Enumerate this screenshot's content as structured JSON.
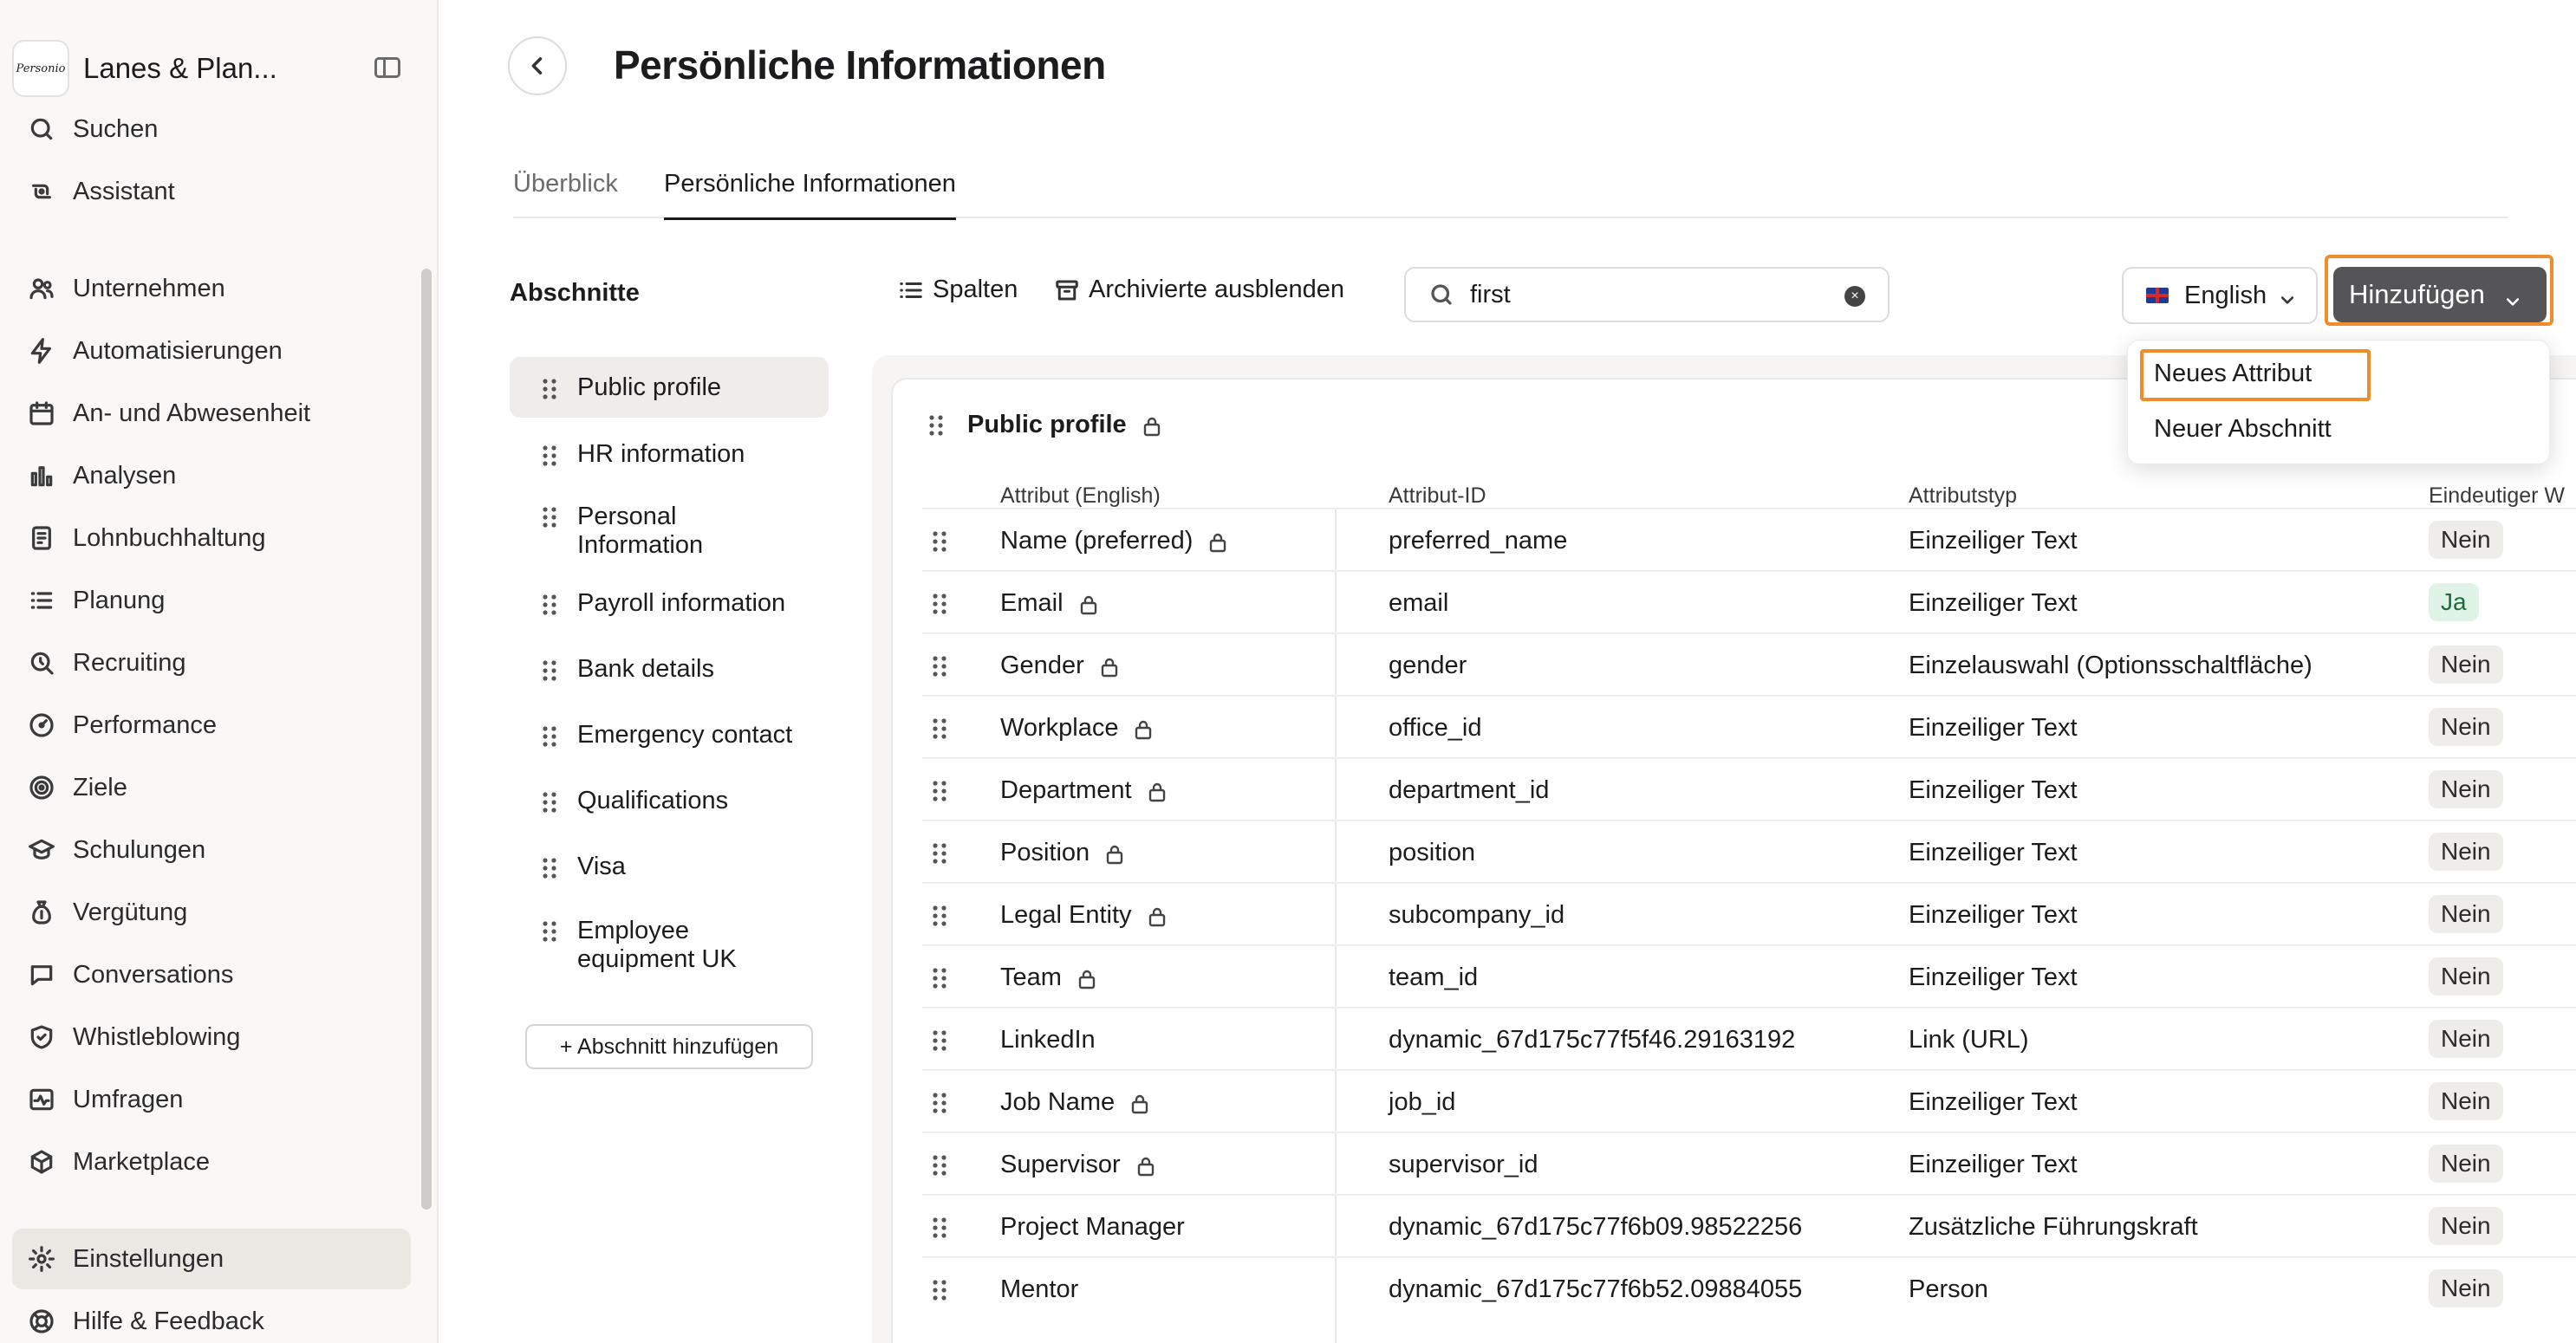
{
  "sidebar": {
    "company": "Lanes & Plan...",
    "logo_text": "Personio",
    "items": [
      {
        "label": "Suchen",
        "icon": "search-icon"
      },
      {
        "label": "Assistant",
        "icon": "assistant-icon"
      },
      {
        "label": "Unternehmen",
        "icon": "people-icon"
      },
      {
        "label": "Automatisierungen",
        "icon": "lightning-icon"
      },
      {
        "label": "An- und Abwesenheit",
        "icon": "calendar-icon"
      },
      {
        "label": "Analysen",
        "icon": "bar-chart-icon"
      },
      {
        "label": "Lohnbuchhaltung",
        "icon": "payroll-icon"
      },
      {
        "label": "Planung",
        "icon": "list-icon"
      },
      {
        "label": "Recruiting",
        "icon": "recruiting-icon"
      },
      {
        "label": "Performance",
        "icon": "gauge-icon"
      },
      {
        "label": "Ziele",
        "icon": "target-icon"
      },
      {
        "label": "Schulungen",
        "icon": "graduation-cap-icon"
      },
      {
        "label": "Vergütung",
        "icon": "money-bag-icon"
      },
      {
        "label": "Conversations",
        "icon": "chat-icon"
      },
      {
        "label": "Whistleblowing",
        "icon": "shield-icon"
      },
      {
        "label": "Umfragen",
        "icon": "pulse-icon"
      },
      {
        "label": "Marketplace",
        "icon": "package-icon"
      },
      {
        "label": "Einstellungen",
        "icon": "gear-icon"
      },
      {
        "label": "Hilfe & Feedback",
        "icon": "lifebuoy-icon"
      }
    ]
  },
  "header": {
    "title": "Persönliche Informationen",
    "tabs": [
      "Überblick",
      "Persönliche Informationen"
    ]
  },
  "toolbar": {
    "sections_label": "Abschnitte",
    "columns_label": "Spalten",
    "archived_label": "Archivierte ausblenden",
    "search_value": "first",
    "language": "English",
    "add_label": "Hinzufügen",
    "dropdown": [
      "Neues Attribut",
      "Neuer Abschnitt"
    ]
  },
  "sections": [
    "Public profile",
    "HR information",
    "Personal Information",
    "Payroll information",
    "Bank details",
    "Emergency contact",
    "Qualifications",
    "Visa",
    "Employee equipment UK"
  ],
  "add_section_label": "+ Abschnitt hinzufügen",
  "table": {
    "title": "Public profile",
    "columns": [
      "Attribut (English)",
      "Attribut-ID",
      "Attributstyp",
      "Eindeutiger W"
    ],
    "rows": [
      {
        "name": "Name (preferred)",
        "locked": true,
        "id": "preferred_name",
        "type": "Einzeiliger Text",
        "unique": "Nein"
      },
      {
        "name": "Email",
        "locked": true,
        "id": "email",
        "type": "Einzeiliger Text",
        "unique": "Ja"
      },
      {
        "name": "Gender",
        "locked": true,
        "id": "gender",
        "type": "Einzelauswahl (Optionsschaltfläche)",
        "unique": "Nein"
      },
      {
        "name": "Workplace",
        "locked": true,
        "id": "office_id",
        "type": "Einzeiliger Text",
        "unique": "Nein"
      },
      {
        "name": "Department",
        "locked": true,
        "id": "department_id",
        "type": "Einzeiliger Text",
        "unique": "Nein"
      },
      {
        "name": "Position",
        "locked": true,
        "id": "position",
        "type": "Einzeiliger Text",
        "unique": "Nein"
      },
      {
        "name": "Legal Entity",
        "locked": true,
        "id": "subcompany_id",
        "type": "Einzeiliger Text",
        "unique": "Nein"
      },
      {
        "name": "Team",
        "locked": true,
        "id": "team_id",
        "type": "Einzeiliger Text",
        "unique": "Nein"
      },
      {
        "name": "LinkedIn",
        "locked": false,
        "id": "dynamic_67d175c77f5f46.29163192",
        "type": "Link (URL)",
        "unique": "Nein"
      },
      {
        "name": "Job Name",
        "locked": true,
        "id": "job_id",
        "type": "Einzeiliger Text",
        "unique": "Nein"
      },
      {
        "name": "Supervisor",
        "locked": true,
        "id": "supervisor_id",
        "type": "Einzeiliger Text",
        "unique": "Nein"
      },
      {
        "name": "Project Manager",
        "locked": false,
        "id": "dynamic_67d175c77f6b09.98522256",
        "type": "Zusätzliche Führungskraft",
        "unique": "Nein"
      },
      {
        "name": "Mentor",
        "locked": false,
        "id": "dynamic_67d175c77f6b52.09884055",
        "type": "Person",
        "unique": "Nein"
      }
    ]
  },
  "colors": {
    "accent_outline": "#f08c2c",
    "add_button": "#555557",
    "yes_pill": "#dff4e6"
  }
}
